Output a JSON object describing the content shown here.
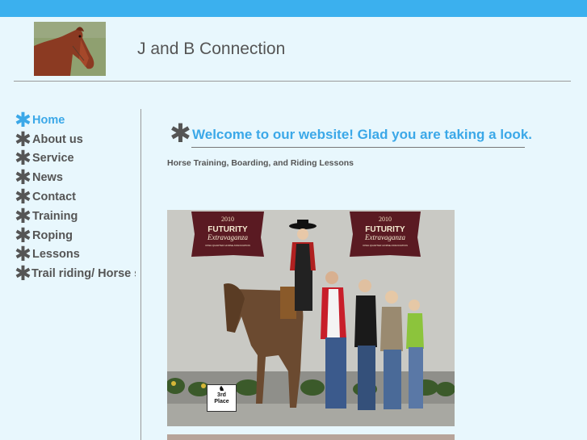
{
  "site": {
    "title": "J and B Connection"
  },
  "nav": {
    "items": [
      {
        "label": "Home",
        "active": true
      },
      {
        "label": "About us",
        "active": false
      },
      {
        "label": "Service",
        "active": false
      },
      {
        "label": "News",
        "active": false
      },
      {
        "label": "Contact",
        "active": false
      },
      {
        "label": "Training",
        "active": false
      },
      {
        "label": "Roping",
        "active": false
      },
      {
        "label": "Lessons",
        "active": false
      },
      {
        "label": "Trail riding/ Horse s",
        "active": false
      }
    ]
  },
  "main": {
    "welcome": "Welcome to our website!  Glad you are taking a look.",
    "tagline": "Horse Training, Boarding, and Riding Lessons",
    "photo": {
      "banner_year": "2010",
      "banner_line1": "FUTURITY",
      "banner_line2": "Extravaganza",
      "banner_line3": "IOWA QUARTER HORSE ASSOCIATION",
      "place_card": "3rd\nPlace"
    }
  },
  "colors": {
    "accent": "#3ba8e8",
    "topbar": "#3bb0ee",
    "background": "#e8f7fd",
    "text": "#555555"
  }
}
